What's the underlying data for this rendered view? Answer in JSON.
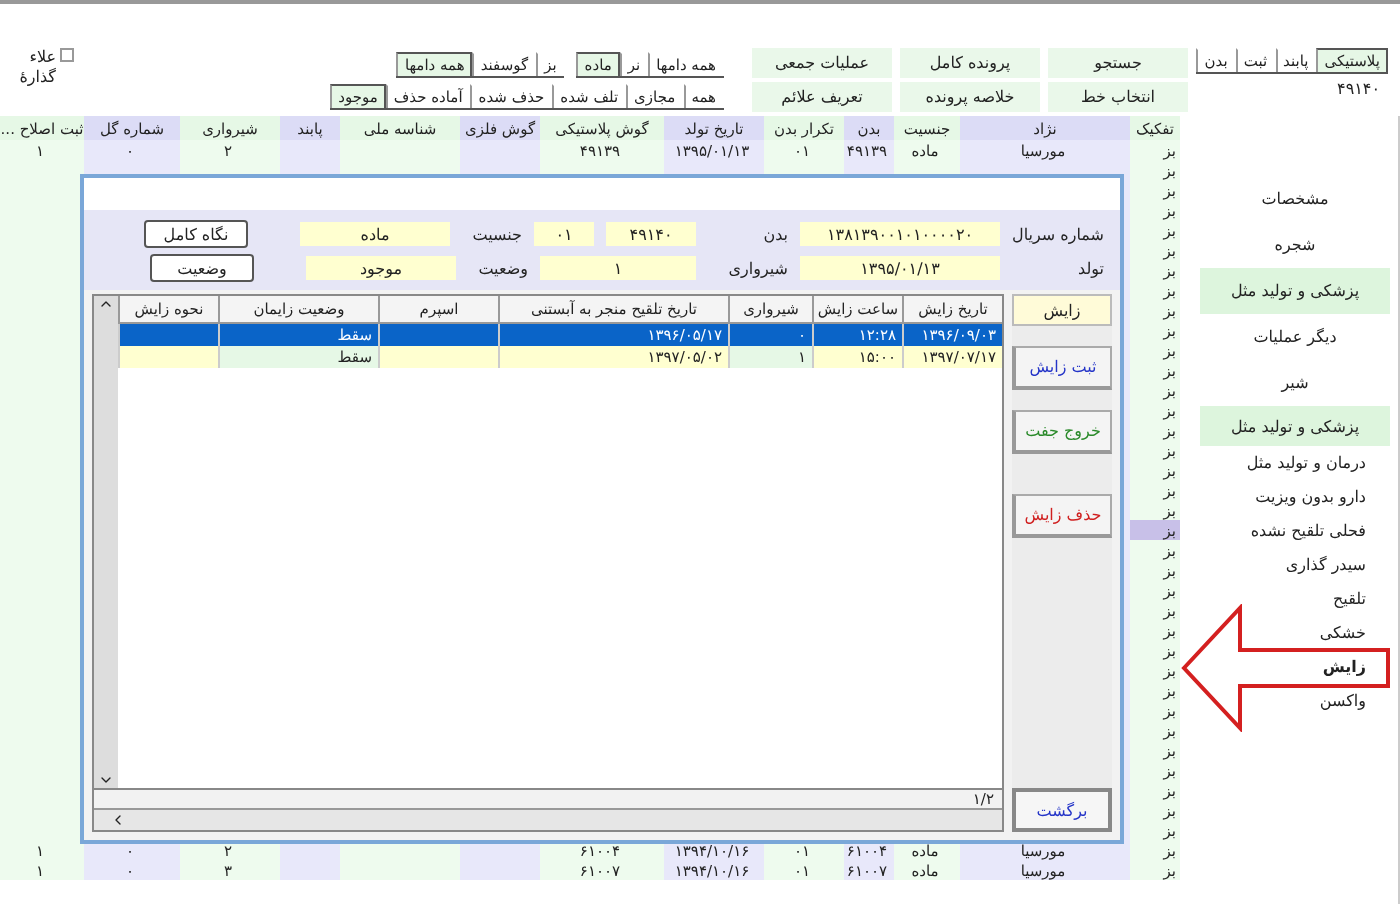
{
  "top_bar": {
    "mark_checkbox": {
      "label": "علاء گذارۀ",
      "checked": false
    },
    "ear_tabs": [
      {
        "label": "پلاستیکی",
        "selected": true
      },
      {
        "label": "پابند",
        "selected": false
      },
      {
        "label": "ثبت",
        "selected": false
      },
      {
        "label": "بدن",
        "selected": false
      }
    ],
    "ear_value": "۴۹۱۴۰",
    "actions": [
      "جستجو",
      "پرونده کامل",
      "عملیات جمعی",
      "انتخاب خط",
      "خلاصه پرونده",
      "تعریف علائم"
    ],
    "sex_tabs": [
      {
        "label": "همه دامها",
        "selected": false
      },
      {
        "label": "نر",
        "selected": false
      },
      {
        "label": "ماده",
        "selected": true
      }
    ],
    "species_tabs": [
      {
        "label": "بز",
        "selected": false
      },
      {
        "label": "گوسفند",
        "selected": false
      },
      {
        "label": "همه دامها",
        "selected": true
      }
    ],
    "status_tabs": [
      {
        "label": "همه",
        "selected": false
      },
      {
        "label": "مجازی",
        "selected": false
      },
      {
        "label": "تلف شده",
        "selected": false
      },
      {
        "label": "حذف شده",
        "selected": false
      },
      {
        "label": "آماده حذف",
        "selected": false
      },
      {
        "label": "موجود",
        "selected": true
      }
    ]
  },
  "table": {
    "columns": [
      "تفکیک",
      "نژاد",
      "جنسیت",
      "بدن",
      "تکرار بدن",
      "تاریخ تولد",
      "گوش پلاستیکی",
      "گوش فلزی",
      "شناسه ملی",
      "پابند",
      "شیرواری",
      "شماره گل",
      "ثبت اصلاح ..."
    ],
    "rows": [
      {
        "cells": [
          "بز",
          "مورسیا",
          "ماده",
          "۴۹۱۳۹",
          "۰۱",
          "۱۳۹۵/۰۱/۱۳",
          "۴۹۱۳۹",
          "",
          "",
          "",
          "۲",
          "۰",
          "۱"
        ],
        "selected": false
      },
      {
        "cells": [
          "بز"
        ],
        "selected": false
      },
      {
        "cells": [
          "بز"
        ],
        "selected": false
      },
      {
        "cells": [
          "بز"
        ],
        "selected": false
      },
      {
        "cells": [
          "بز"
        ],
        "selected": false
      },
      {
        "cells": [
          "بز"
        ],
        "selected": false
      },
      {
        "cells": [
          "بز"
        ],
        "selected": false
      },
      {
        "cells": [
          "بز"
        ],
        "selected": false
      },
      {
        "cells": [
          "بز"
        ],
        "selected": false
      },
      {
        "cells": [
          "بز"
        ],
        "selected": false
      },
      {
        "cells": [
          "بز"
        ],
        "selected": false
      },
      {
        "cells": [
          "بز"
        ],
        "selected": false
      },
      {
        "cells": [
          "بز"
        ],
        "selected": false
      },
      {
        "cells": [
          "بز"
        ],
        "selected": false
      },
      {
        "cells": [
          "بز"
        ],
        "selected": false
      },
      {
        "cells": [
          "بز"
        ],
        "selected": false
      },
      {
        "cells": [
          "بز"
        ],
        "selected": false
      },
      {
        "cells": [
          "بز"
        ],
        "selected": false
      },
      {
        "cells": [
          "بز"
        ],
        "selected": false
      },
      {
        "cells": [
          "بز"
        ],
        "selected": true
      },
      {
        "cells": [
          "بز"
        ],
        "selected": false
      },
      {
        "cells": [
          "بز"
        ],
        "selected": false
      },
      {
        "cells": [
          "بز"
        ],
        "selected": false
      },
      {
        "cells": [
          "بز"
        ],
        "selected": false
      },
      {
        "cells": [
          "بز"
        ],
        "selected": false
      },
      {
        "cells": [
          "بز"
        ],
        "selected": false
      },
      {
        "cells": [
          "بز"
        ],
        "selected": false
      },
      {
        "cells": [
          "بز"
        ],
        "selected": false
      },
      {
        "cells": [
          "بز"
        ],
        "selected": false
      },
      {
        "cells": [
          "بز"
        ],
        "selected": false
      },
      {
        "cells": [
          "بز"
        ],
        "selected": false
      },
      {
        "cells": [
          "بز"
        ],
        "selected": false
      },
      {
        "cells": [
          "بز"
        ],
        "selected": false
      },
      {
        "cells": [
          "بز"
        ],
        "selected": false
      },
      {
        "cells": [
          "بز"
        ],
        "selected": false
      },
      {
        "cells": [
          "بز",
          "مورسیا",
          "ماده",
          "۶۱۰۰۴",
          "۰۱",
          "۱۳۹۴/۱۰/۱۶",
          "۶۱۰۰۴",
          "",
          "",
          "",
          "۲",
          "۰",
          "۱"
        ],
        "selected": false
      },
      {
        "cells": [
          "بز",
          "مورسیا",
          "ماده",
          "۶۱۰۰۷",
          "۰۱",
          "۱۳۹۴/۱۰/۱۶",
          "۶۱۰۰۷",
          "",
          "",
          "",
          "۳",
          "۰",
          "۱"
        ],
        "selected": false
      }
    ]
  },
  "sidebar": {
    "items": [
      {
        "label": "مشخصات",
        "kind": "button",
        "selected": false
      },
      {
        "label": "شجره",
        "kind": "button",
        "selected": false
      },
      {
        "label": "پزشکی و تولید مثل",
        "kind": "button",
        "selected": true
      },
      {
        "label": "دیگر عملیات",
        "kind": "button",
        "selected": false
      },
      {
        "label": "شیر",
        "kind": "button",
        "selected": false
      },
      {
        "label": "پزشکی و تولید مثل",
        "kind": "header",
        "selected": false
      },
      {
        "label": "درمان و تولید مثل",
        "kind": "link",
        "selected": false
      },
      {
        "label": "دارو بدون ویزیت",
        "kind": "link",
        "selected": false
      },
      {
        "label": "فحلی تلقیح نشده",
        "kind": "link",
        "selected": false
      },
      {
        "label": "سیدر گذاری",
        "kind": "link",
        "selected": false
      },
      {
        "label": "تلقیح",
        "kind": "link",
        "selected": false
      },
      {
        "label": "خشکی",
        "kind": "link",
        "selected": false
      },
      {
        "label": "زایش",
        "kind": "link",
        "selected": true
      },
      {
        "label": "واکسن",
        "kind": "link",
        "selected": false
      }
    ]
  },
  "dialog": {
    "info": {
      "fields": [
        {
          "label": "شماره سریال",
          "values": [
            "۱۳۸۱۳۹۰۰۱۰۱۰۰۰۰۲۰"
          ]
        },
        {
          "label": "بدن",
          "values": [
            "۴۹۱۴۰",
            "۰۱"
          ]
        },
        {
          "label": "جنسیت",
          "values": [
            "ماده"
          ]
        },
        {
          "label": "تولد",
          "values": [
            "۱۳۹۵/۰۱/۱۳"
          ]
        },
        {
          "label": "شیرواری",
          "values": [
            "۱"
          ]
        },
        {
          "label": "وضعیت",
          "values": [
            "موجود"
          ]
        }
      ],
      "buttons": [
        "نگاه کامل",
        "وضعیت"
      ]
    },
    "panel_tab": "زایش",
    "side_buttons": [
      {
        "label": "ثبت زایش",
        "kind": "add"
      },
      {
        "label": "خروج جفت",
        "kind": "placenta"
      },
      {
        "label": "حذف زایش",
        "kind": "delete"
      }
    ],
    "back_button": "برگشت",
    "columns": [
      "تاریخ زایش",
      "ساعت زایش",
      "شیرواری",
      "تاریخ تلقیح منجر به آبستنی",
      "اسپرم",
      "وضعیت زایمان",
      "نحوه زایش"
    ],
    "rows": [
      {
        "cells": [
          "۱۳۹۶/۰۹/۰۳",
          "۱۲:۲۸",
          "۰",
          "۱۳۹۶/۰۵/۱۷",
          "",
          "سقط",
          ""
        ],
        "selected": true
      },
      {
        "cells": [
          "۱۳۹۷/۰۷/۱۷",
          "۱۵:۰۰",
          "۱",
          "۱۳۹۷/۰۵/۰۲",
          "",
          "سقط",
          ""
        ],
        "selected": false
      }
    ],
    "record_count": "۱/۲"
  }
}
